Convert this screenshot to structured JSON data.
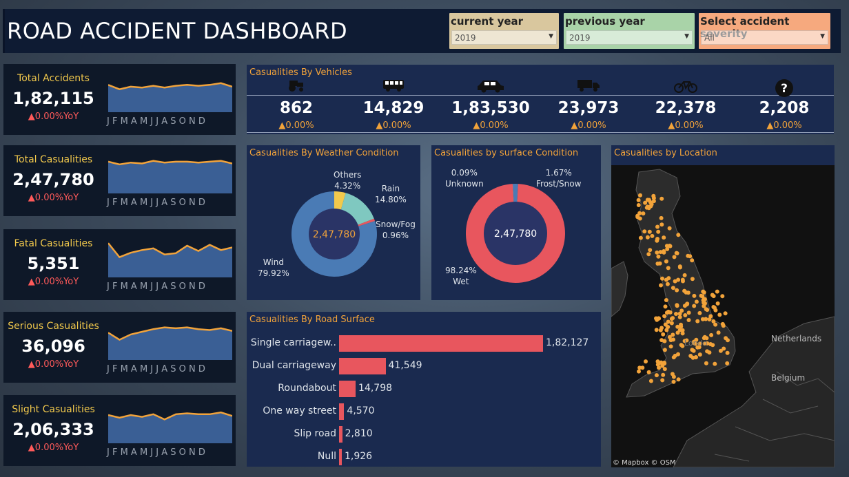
{
  "header": {
    "title": "ROAD ACCIDENT DASHBOARD"
  },
  "filters": [
    {
      "label": "current year",
      "value": "2019",
      "color": "#d9c79e"
    },
    {
      "label": "previous year",
      "value": "2019",
      "color": "#a9d3a8"
    },
    {
      "label": "Select accident severity",
      "value": "All",
      "color": "#f6a97e"
    }
  ],
  "months": "J F M A M J J A S O N D",
  "kpis": [
    {
      "label": "Total Accidents",
      "value": "1,82,115",
      "yoy": "▲0.00%YoY",
      "trend": [
        0.62,
        0.52,
        0.58,
        0.56,
        0.6,
        0.56,
        0.6,
        0.62,
        0.6,
        0.62,
        0.66,
        0.58
      ]
    },
    {
      "label": "Total Casualities",
      "value": "2,47,780",
      "yoy": "▲0.00%YoY",
      "trend": [
        0.72,
        0.66,
        0.7,
        0.68,
        0.74,
        0.7,
        0.72,
        0.72,
        0.7,
        0.72,
        0.74,
        0.68
      ]
    },
    {
      "label": "Fatal Casualities",
      "value": "5,351",
      "yoy": "▲0.00%YoY",
      "trend": [
        0.78,
        0.46,
        0.56,
        0.62,
        0.66,
        0.52,
        0.55,
        0.72,
        0.6,
        0.74,
        0.62,
        0.68
      ]
    },
    {
      "label": "Serious Casualities",
      "value": "36,096",
      "yoy": "▲0.00%YoY",
      "trend": [
        0.62,
        0.46,
        0.58,
        0.64,
        0.7,
        0.74,
        0.72,
        0.74,
        0.7,
        0.68,
        0.72,
        0.66
      ]
    },
    {
      "label": "Slight Casualities",
      "value": "2,06,333",
      "yoy": "▲0.00%YoY",
      "trend": [
        0.64,
        0.58,
        0.64,
        0.6,
        0.66,
        0.54,
        0.66,
        0.68,
        0.66,
        0.66,
        0.7,
        0.62
      ]
    }
  ],
  "vehicles": {
    "title": "Casualities By Vehicles",
    "items": [
      {
        "icon": "tractor-icon",
        "value": "862",
        "yoy": "▲0.00%"
      },
      {
        "icon": "bus-icon",
        "value": "14,829",
        "yoy": "▲0.00%"
      },
      {
        "icon": "car-icon",
        "value": "1,83,530",
        "yoy": "▲0.00%"
      },
      {
        "icon": "truck-icon",
        "value": "23,973",
        "yoy": "▲0.00%"
      },
      {
        "icon": "bicycle-icon",
        "value": "22,378",
        "yoy": "▲0.00%"
      },
      {
        "icon": "question-icon",
        "value": "2,208",
        "yoy": "▲0.00%"
      }
    ]
  },
  "weather": {
    "title": "Casualities By Weather Condition",
    "center": "2,47,780",
    "slices": [
      {
        "name": "Wind",
        "pct": "79.92%",
        "value": 79.92,
        "color": "#4a7bb5"
      },
      {
        "name": "Others",
        "pct": "4.32%",
        "value": 4.32,
        "color": "#f2c94c"
      },
      {
        "name": "Rain",
        "pct": "14.80%",
        "value": 14.8,
        "color": "#7fc8c0"
      },
      {
        "name": "Snow/Fog",
        "pct": "0.96%",
        "value": 0.96,
        "color": "#e8565e"
      }
    ]
  },
  "surface": {
    "title": "Casualities by surface Condition",
    "center": "2,47,780",
    "slices": [
      {
        "name": "Wet",
        "pct": "98.24%",
        "value": 98.24,
        "color": "#e8565e"
      },
      {
        "name": "Unknown",
        "pct": "0.09%",
        "value": 0.09,
        "color": "#9aa3b0"
      },
      {
        "name": "Frost/Snow",
        "pct": "1.67%",
        "value": 1.67,
        "color": "#4a7bb5"
      }
    ]
  },
  "road": {
    "title": "Casualities By Road Surface",
    "bars": [
      {
        "label": "Single carriagew..",
        "value": 182127,
        "display": "1,82,127"
      },
      {
        "label": "Dual carriageway",
        "value": 41549,
        "display": "41,549"
      },
      {
        "label": "Roundabout",
        "value": 14798,
        "display": "14,798"
      },
      {
        "label": "One way street",
        "value": 4570,
        "display": "4,570"
      },
      {
        "label": "Slip road",
        "value": 2810,
        "display": "2,810"
      },
      {
        "label": "Null",
        "value": 1926,
        "display": "1,926"
      }
    ]
  },
  "location": {
    "title": "Casualities by  Location",
    "labels": [
      "Netherlands",
      "Belgium"
    ],
    "attribution": "© Mapbox © OSM",
    "city": "Londo"
  },
  "colors": {
    "accent": "#f2a33a",
    "panel": "#1a2a4f",
    "bar": "#e8565e",
    "kpiLabel": "#f2c94c"
  }
}
